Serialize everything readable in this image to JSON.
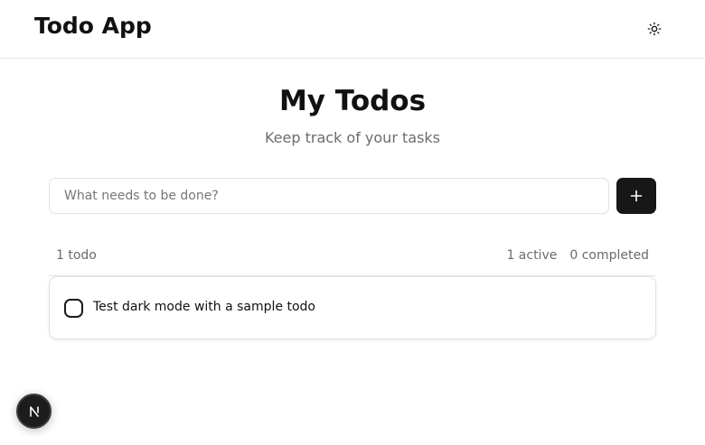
{
  "header": {
    "title": "Todo App",
    "theme_toggle_icon": "sun-icon"
  },
  "main": {
    "title": "My Todos",
    "subtitle": "Keep track of your tasks"
  },
  "new_todo": {
    "placeholder": "What needs to be done?",
    "value": "",
    "add_icon": "plus-icon"
  },
  "stats": {
    "count": "1 todo",
    "active": "1 active",
    "completed": "0 completed"
  },
  "todos": [
    {
      "text": "Test dark mode with a sample todo",
      "completed": false
    }
  ],
  "dev_badge": {
    "letter": "N",
    "icon": "nextjs-logo-icon"
  },
  "colors": {
    "accent": "#171717",
    "muted_text": "#6b6b6b",
    "border": "#e5e5e5"
  }
}
